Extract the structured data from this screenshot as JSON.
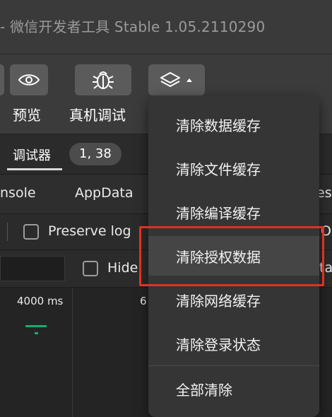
{
  "window": {
    "title": "- 微信开发者工具 Stable 1.05.2110290"
  },
  "toolbar": {
    "preview_label": "预览",
    "remote_debug_label": "真机调试"
  },
  "devtools": {
    "debugger_tab": "调试器",
    "badge": "1, 38",
    "tabs": [
      "nsole",
      "AppData",
      "es"
    ],
    "preserve_log_label": "Preserve log",
    "filter_end_char": "O",
    "hide_label": "Hide",
    "hide_end_char": "ta",
    "timeline_label_1": "4000 ms",
    "timeline_label_2": "6"
  },
  "menu": {
    "items": [
      "清除数据缓存",
      "清除文件缓存",
      "清除编译缓存",
      "清除授权数据",
      "清除网络缓存",
      "清除登录状态",
      "全部清除"
    ],
    "highlighted_index": 3
  },
  "colors": {
    "highlight": "#e0321f",
    "accent": "#1aad6b"
  }
}
